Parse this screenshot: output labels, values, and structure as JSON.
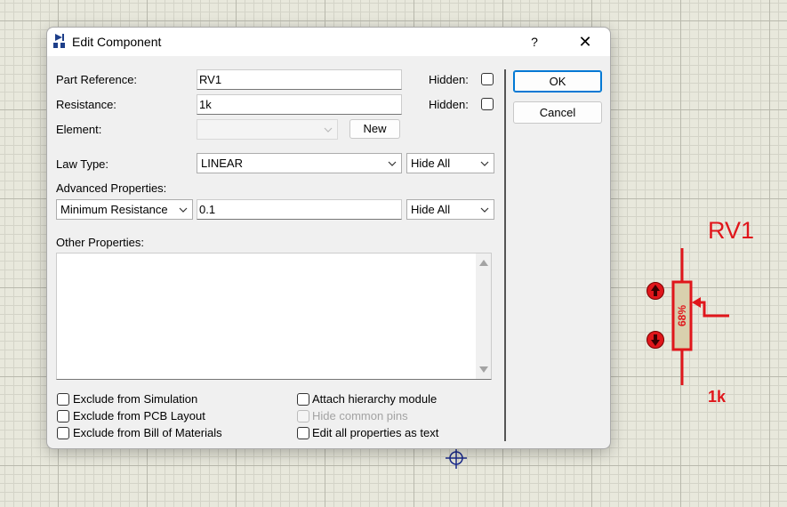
{
  "dialog": {
    "title": "Edit Component",
    "help_label": "?",
    "close_label": "✕",
    "part_reference_label": "Part Reference:",
    "part_reference_value": "RV1",
    "resistance_label": "Resistance:",
    "resistance_value": "1k",
    "hidden_label": "Hidden:",
    "element_label": "Element:",
    "element_value": "",
    "new_button": "New",
    "law_type_label": "Law Type:",
    "law_type_value": "LINEAR",
    "law_type_visibility": "Hide All",
    "advanced_properties_label": "Advanced Properties:",
    "advanced_property_name": "Minimum Resistance",
    "advanced_property_value": "0.1",
    "advanced_property_visibility": "Hide All",
    "other_properties_label": "Other Properties:",
    "other_properties_value": "",
    "ok_button": "OK",
    "cancel_button": "Cancel",
    "checkboxes_left": [
      {
        "label": "Exclude from Simulation",
        "checked": false,
        "enabled": true
      },
      {
        "label": "Exclude from PCB Layout",
        "checked": false,
        "enabled": true
      },
      {
        "label": "Exclude from Bill of Materials",
        "checked": false,
        "enabled": true
      }
    ],
    "checkboxes_right": [
      {
        "label": "Attach hierarchy module",
        "checked": false,
        "enabled": true
      },
      {
        "label": "Hide common pins",
        "checked": false,
        "enabled": false
      },
      {
        "label": "Edit all properties as text",
        "checked": false,
        "enabled": true
      }
    ]
  },
  "schematic": {
    "component_reference": "RV1",
    "component_value": "1k",
    "wiper_position": "68%",
    "increment_icon": "arrow-up-icon",
    "decrement_icon": "arrow-down-icon",
    "origin_icon": "crosshair-icon",
    "color": "#e0161b",
    "grid_color": "#e8e8dc"
  }
}
